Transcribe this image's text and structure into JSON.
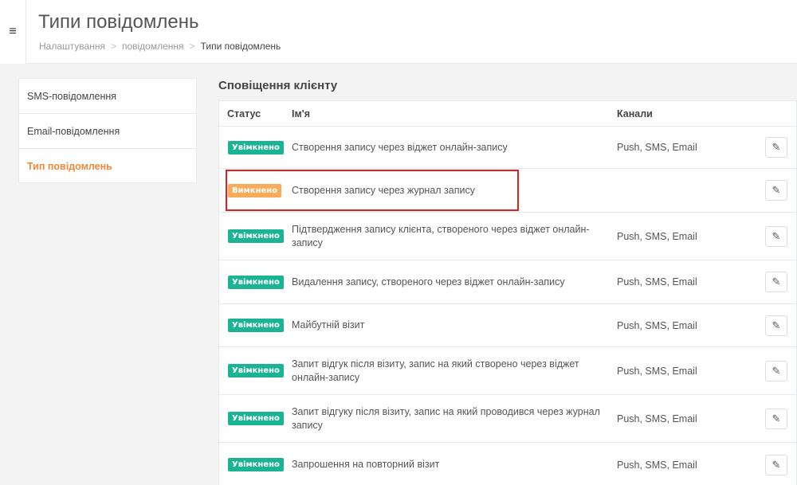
{
  "header": {
    "menu_icon": "≡",
    "title": "Типи повідомлень",
    "breadcrumb": {
      "items": [
        "Налаштування",
        "повідомлення",
        "Типи повідомлень"
      ],
      "separator": ">"
    }
  },
  "sidebar": {
    "items": [
      {
        "label": "SMS-повідомлення"
      },
      {
        "label": "Email-повідомлення"
      },
      {
        "label": "Тип повідомлень",
        "active": true
      }
    ]
  },
  "section": {
    "title": "Сповіщення клієнту"
  },
  "table": {
    "headers": {
      "status": "Статус",
      "name": "Ім'я",
      "channels": "Канали"
    },
    "rows": [
      {
        "status": "Увімкнено",
        "name": "Створення запису через віджет онлайн-запису",
        "channels": "Push, SMS, Email"
      },
      {
        "status": "Вимкнено",
        "name": "Створення запису через журнал запису",
        "channels": ""
      },
      {
        "status": "Увімкнено",
        "name": "Підтвердження запису клієнта, створеного через віджет онлайн-запису",
        "channels": "Push, SMS, Email"
      },
      {
        "status": "Увімкнено",
        "name": "Видалення запису, створеного через віджет онлайн-запису",
        "channels": "Push, SMS, Email"
      },
      {
        "status": "Увімкнено",
        "name": "Майбутній візит",
        "channels": "Push, SMS, Email"
      },
      {
        "status": "Увімкнено",
        "name": "Запит відгук після візиту, запис на який створено через віджет онлайн-запису",
        "channels": "Push, SMS, Email"
      },
      {
        "status": "Увімкнено",
        "name": "Запит відгуку після візиту, запис на який проводився через журнал запису",
        "channels": "Push, SMS, Email"
      },
      {
        "status": "Увімкнено",
        "name": "Запрошення на повторний візит",
        "channels": "Push, SMS, Email"
      }
    ],
    "edit_icon": "✎"
  },
  "colors": {
    "enabled_badge": "#1ab394",
    "disabled_badge": "#f8ac59",
    "active_sidebar": "#f0883a",
    "highlight_box": "#e41e1e"
  },
  "icons": {
    "menu": "hamburger-menu-icon",
    "edit": "pencil-icon"
  }
}
